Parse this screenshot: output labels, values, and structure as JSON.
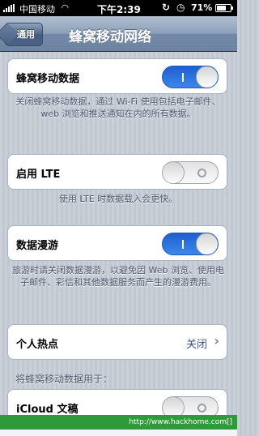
{
  "status_bar": {
    "carrier": "中国移动",
    "time": "下午2:39",
    "battery_percent": "71%",
    "battery_level": 0.71,
    "wifi_icon": "wifi-icon",
    "lock_icon": "orientation-lock-icon"
  },
  "nav": {
    "back_label": "通用",
    "title": "蜂窝移动网络"
  },
  "cellular_data": {
    "label": "蜂窝移动数据",
    "state": "on",
    "description": "关闭蜂窝移动数据，通过 Wi-Fi 使用包括电子邮件、web 浏览和推送通知在内的所有数据。"
  },
  "lte": {
    "label": "启用 LTE",
    "state": "off",
    "description": "使用 LTE 时数据载入会更快。"
  },
  "roaming": {
    "label": "数据漫游",
    "state": "on",
    "description": "旅游时请关闭数据漫游，以避免因 Web 浏览、使用电子邮件、彩信和其他数据服务而产生的漫游费用。"
  },
  "hotspot": {
    "label": "个人热点",
    "value": "关闭"
  },
  "section_header": "将蜂窝移动数据用于：",
  "icloud_docs": {
    "label": "iCloud 文稿",
    "state": "off"
  },
  "watermark": "http://www.hackhome.com[]"
}
